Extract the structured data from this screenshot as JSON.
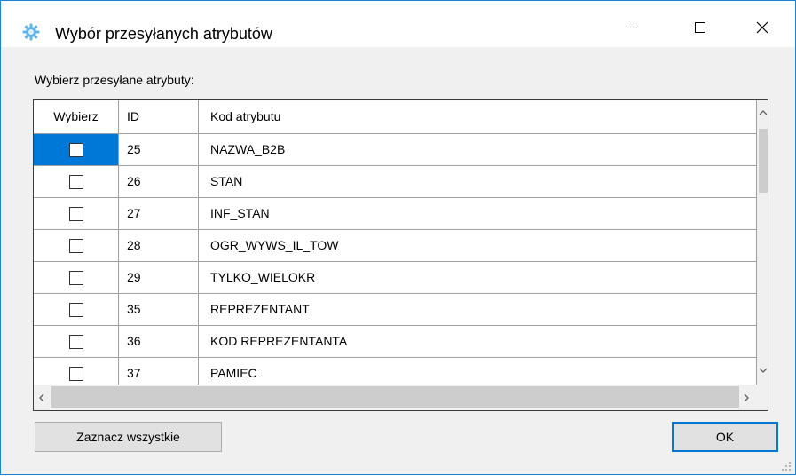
{
  "window": {
    "title": "Wybór przesyłanych atrybutów",
    "accent": "#1883d7"
  },
  "label": "Wybierz przesyłane atrybuty:",
  "grid": {
    "columns": [
      "Wybierz",
      "ID",
      "Kod atrybutu"
    ],
    "rows": [
      {
        "checked": false,
        "id": "25",
        "code": "NAZWA_B2B"
      },
      {
        "checked": false,
        "id": "26",
        "code": "STAN"
      },
      {
        "checked": false,
        "id": "27",
        "code": "INF_STAN"
      },
      {
        "checked": false,
        "id": "28",
        "code": "OGR_WYWS_IL_TOW"
      },
      {
        "checked": false,
        "id": "29",
        "code": "TYLKO_WIELOKR"
      },
      {
        "checked": false,
        "id": "35",
        "code": "REPREZENTANT"
      },
      {
        "checked": false,
        "id": "36",
        "code": "KOD REPREZENTANTA"
      },
      {
        "checked": false,
        "id": "37",
        "code": "PAMIEC"
      }
    ],
    "selection_color": "#0078d7"
  },
  "buttons": {
    "select_all": "Zaznacz wszystkie",
    "ok": "OK"
  },
  "icons": {
    "app": "gear-cog-icon",
    "minimize": "minimize-icon",
    "maximize": "maximize-icon",
    "close": "close-icon"
  }
}
